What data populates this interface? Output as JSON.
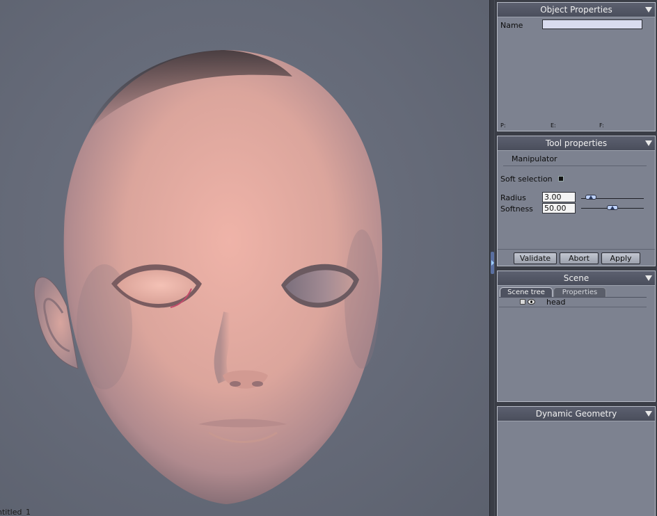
{
  "viewport": {
    "document_label": "ntitled_1"
  },
  "object_properties": {
    "title": "Object Properties",
    "name_label": "Name",
    "name_value": "",
    "stat_p": "P:",
    "stat_e": "E:",
    "stat_f": "F:"
  },
  "tool_properties": {
    "title": "Tool properties",
    "tool_name": "Manipulator",
    "soft_selection_label": "Soft selection",
    "soft_selection_checked": true,
    "radius_label": "Radius",
    "radius_value": "3.00",
    "radius_level": 0.08,
    "softness_label": "Softness",
    "softness_value": "50.00",
    "softness_level": 0.5,
    "validate_label": "Validate",
    "abort_label": "Abort",
    "apply_label": "Apply"
  },
  "scene": {
    "title": "Scene",
    "tabs": [
      "Scene tree",
      "Properties"
    ],
    "active_tab": 0,
    "tree_items": [
      {
        "label": "head",
        "icons": [
          "lock-icon",
          "eye-icon"
        ]
      }
    ]
  },
  "dynamic_geometry": {
    "title": "Dynamic Geometry"
  },
  "colors": {
    "viewport_bg": "#656a78",
    "panel_bg": "#7d8290",
    "panel_header": "#4e5260",
    "skin": "#e0a89e"
  }
}
